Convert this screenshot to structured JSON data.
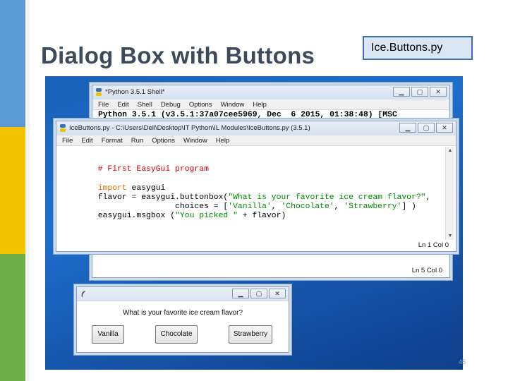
{
  "slide": {
    "title": "Dialog Box with Buttons",
    "file_label": "Ice.Buttons.py",
    "page_number": "45"
  },
  "colors": {
    "strip_blue": "#5b9bd5",
    "strip_yellow": "#f5c200",
    "strip_green": "#70ad47",
    "title_text": "#3d4a5c",
    "desktop_blue": "#1d6fcd"
  },
  "shell": {
    "title": "*Python 3.5.1 Shell*",
    "menu": [
      "File",
      "Edit",
      "Shell",
      "Debug",
      "Options",
      "Window",
      "Help"
    ],
    "first_line": "Python 3.5.1 (v3.5.1:37a07cee5969, Dec  6 2015, 01:38:48) [MSC",
    "status": "Ln 5  Col 0"
  },
  "editor": {
    "title": "IceButtons.py - C:\\Users\\Dell\\Desktop\\IT Python\\IL Modules\\IceButtons.py (3.5.1)",
    "menu": [
      "File",
      "Edit",
      "Format",
      "Run",
      "Options",
      "Window",
      "Help"
    ],
    "code": {
      "comment": "# First EasyGui program",
      "import_kw": "import",
      "import_mod": " easygui",
      "line3_a": "flavor = easygui.buttonbox(",
      "line3_str": "\"What is your favorite ice cream flavor?\"",
      "line3_end": ",",
      "line4_a": "                choices = [",
      "line4_s1": "'Vanilla'",
      "line4_c1": ", ",
      "line4_s2": "'Chocolate'",
      "line4_c2": ", ",
      "line4_s3": "'Strawberry'",
      "line4_end": "] )",
      "line5_a": "easygui.msgbox (",
      "line5_str": "\"You picked \"",
      "line5_end": " + flavor)"
    },
    "status": "Ln 1  Col 0"
  },
  "dialog": {
    "prompt": "What is your favorite ice cream flavor?",
    "buttons": [
      "Vanilla",
      "Chocolate",
      "Strawberry"
    ]
  },
  "controls": {
    "minimize": "▁",
    "maximize": "▢",
    "close": "✕"
  }
}
